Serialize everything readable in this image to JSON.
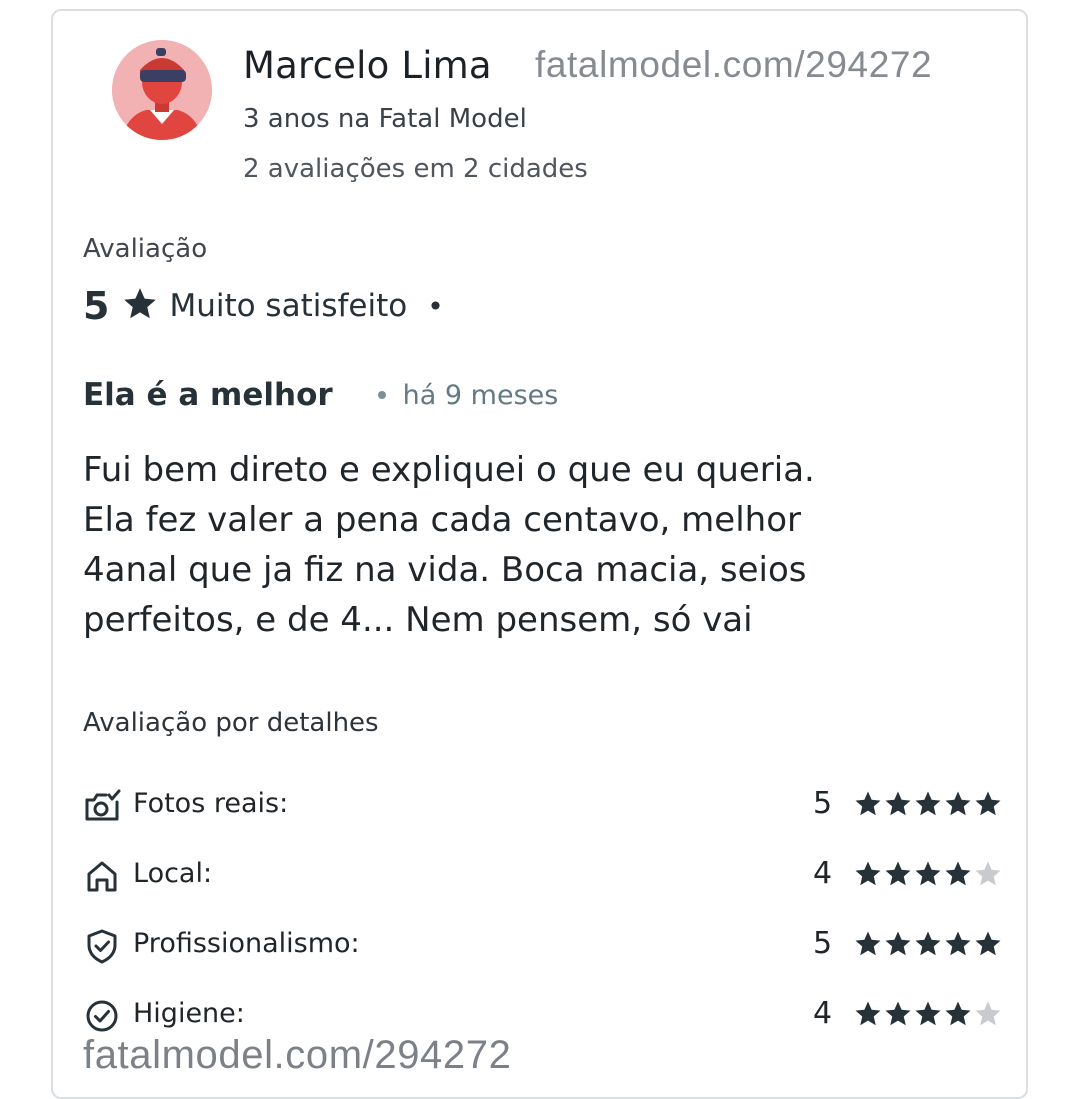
{
  "reviewer": {
    "name": "Marcelo Lima",
    "member_since": "3 anos na Fatal Model",
    "reviews_count": "2 avaliações em 2 cidades"
  },
  "watermark": "fatalmodel.com/294272",
  "rating": {
    "label": "Avaliação",
    "value": "5",
    "text": "Muito satisfeito",
    "dot": "•"
  },
  "review": {
    "title": "Ela é a melhor",
    "time": "há 9 meses",
    "lines": [
      "Fui bem direto e expliquei o que eu queria.",
      "Ela fez valer a pena cada centavo, melhor",
      "4anal que ja fiz na vida. Boca macia, seios",
      "perfeitos, e de 4... Nem pensem, só vai"
    ]
  },
  "details": {
    "label": "Avaliação por detalhes",
    "items": [
      {
        "icon": "camera-check-icon",
        "label": "Fotos reais:",
        "score": "5",
        "stars": 5
      },
      {
        "icon": "home-icon",
        "label": "Local:",
        "score": "4",
        "stars": 4
      },
      {
        "icon": "shield-check-icon",
        "label": "Profissionalismo:",
        "score": "5",
        "stars": 5
      },
      {
        "icon": "check-circle-icon",
        "label": "Higiene:",
        "score": "4",
        "stars": 4
      }
    ]
  },
  "colors": {
    "star_filled": "#263238",
    "star_empty": "#c7cbce",
    "avatar_bg": "#f2b1b3",
    "avatar_figure": "#e0463f"
  }
}
